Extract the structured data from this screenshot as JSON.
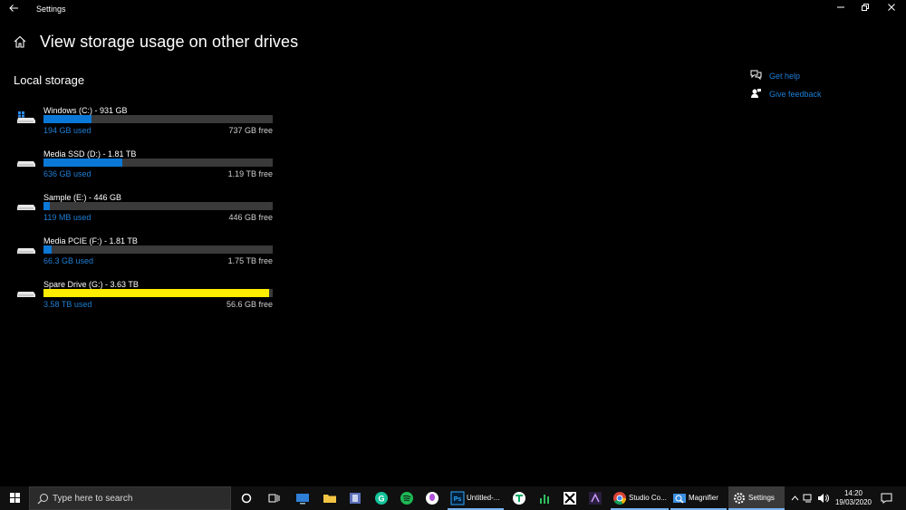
{
  "window": {
    "title": "Settings",
    "back_icon": "back-arrow-icon",
    "controls": [
      "minimize",
      "maximize",
      "close"
    ]
  },
  "header": {
    "title": "View storage usage on other drives",
    "home_icon": "home-icon"
  },
  "section": {
    "title": "Local storage"
  },
  "drives": [
    {
      "name": "Windows (C:) - 931 GB",
      "used": "194 GB used",
      "free": "737 GB free",
      "used_fraction": 0.208,
      "color": "#0a78d7",
      "icon": "windows-drive-icon"
    },
    {
      "name": "Media SSD (D:) - 1.81 TB",
      "used": "636 GB used",
      "free": "1.19 TB free",
      "used_fraction": 0.343,
      "color": "#0a78d7",
      "icon": "drive-icon"
    },
    {
      "name": "Sample (E:) - 446 GB",
      "used": "119 MB used",
      "free": "446 GB free",
      "used_fraction": 0.0003,
      "color": "#0a78d7",
      "icon": "drive-icon"
    },
    {
      "name": "Media PCIE (F:) - 1.81 TB",
      "used": "66.3 GB used",
      "free": "1.75 TB free",
      "used_fraction": 0.036,
      "color": "#0a78d7",
      "icon": "drive-icon"
    },
    {
      "name": "Spare Drive (G:) - 3.63 TB",
      "used": "3.58 TB used",
      "free": "56.6 GB free",
      "used_fraction": 0.985,
      "color": "#ffee00",
      "icon": "drive-icon"
    }
  ],
  "help": {
    "get_help": "Get help",
    "give_feedback": "Give feedback"
  },
  "taskbar": {
    "search_placeholder": "Type here to search",
    "apps": [
      {
        "label": "Untitled-...",
        "icon": "photoshop-icon"
      },
      {
        "label": "Studio Co...",
        "icon": "chrome-icon"
      },
      {
        "label": "Magnifier",
        "icon": "magnifier-icon"
      },
      {
        "label": "Settings",
        "icon": "gear-icon"
      }
    ],
    "time": "14:20",
    "date": "19/03/2020"
  }
}
